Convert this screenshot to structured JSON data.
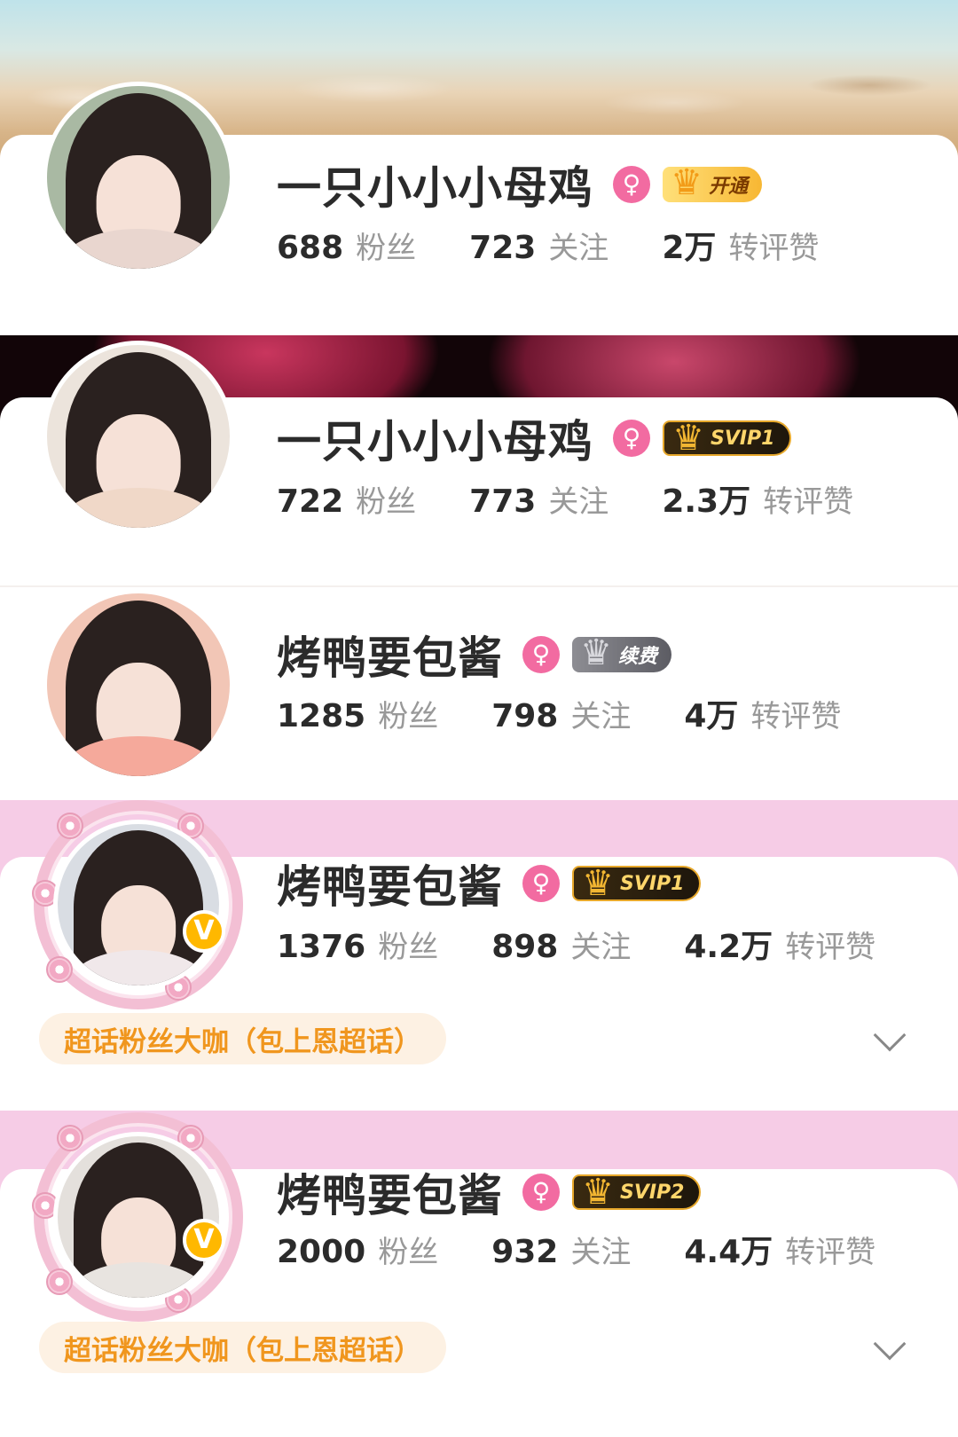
{
  "profiles": [
    {
      "name": "一只小小小母鸡",
      "gender_icon": "♀",
      "vip_label": "开通",
      "vip_style": "gold",
      "crown_icon": "♛",
      "fans_count": "688",
      "fans_label": "粉丝",
      "following_count": "723",
      "following_label": "关注",
      "interactions_count": "2万",
      "interactions_label": "转评赞"
    },
    {
      "name": "一只小小小母鸡",
      "gender_icon": "♀",
      "vip_label": "SVIP1",
      "vip_style": "dark",
      "crown_icon": "♛",
      "fans_count": "722",
      "fans_label": "粉丝",
      "following_count": "773",
      "following_label": "关注",
      "interactions_count": "2.3万",
      "interactions_label": "转评赞"
    },
    {
      "name": "烤鸭要包酱",
      "gender_icon": "♀",
      "vip_label": "续费",
      "vip_style": "silver",
      "crown_icon": "♛",
      "fans_count": "1285",
      "fans_label": "粉丝",
      "following_count": "798",
      "following_label": "关注",
      "interactions_count": "4万",
      "interactions_label": "转评赞"
    },
    {
      "name": "烤鸭要包酱",
      "gender_icon": "♀",
      "vip_label": "SVIP1",
      "vip_style": "dark",
      "crown_icon": "♛",
      "verified_icon": "V",
      "fans_count": "1376",
      "fans_label": "粉丝",
      "following_count": "898",
      "following_label": "关注",
      "interactions_count": "4.2万",
      "interactions_label": "转评赞",
      "super_topic_tag": "超话粉丝大咖（包上恩超话）"
    },
    {
      "name": "烤鸭要包酱",
      "gender_icon": "♀",
      "vip_label": "SVIP2",
      "vip_style": "dark",
      "crown_icon": "♛",
      "verified_icon": "V",
      "fans_count": "2000",
      "fans_label": "粉丝",
      "following_count": "932",
      "following_label": "关注",
      "interactions_count": "4.4万",
      "interactions_label": "转评赞",
      "super_topic_tag": "超话粉丝大咖（包上恩超话）"
    }
  ],
  "colors": {
    "gender_pink": "#f26ba1",
    "stat_label": "#999999",
    "tag_orange": "#f0961e",
    "banner_pink": "#f6cce6",
    "verified_gold": "#ffb800"
  }
}
